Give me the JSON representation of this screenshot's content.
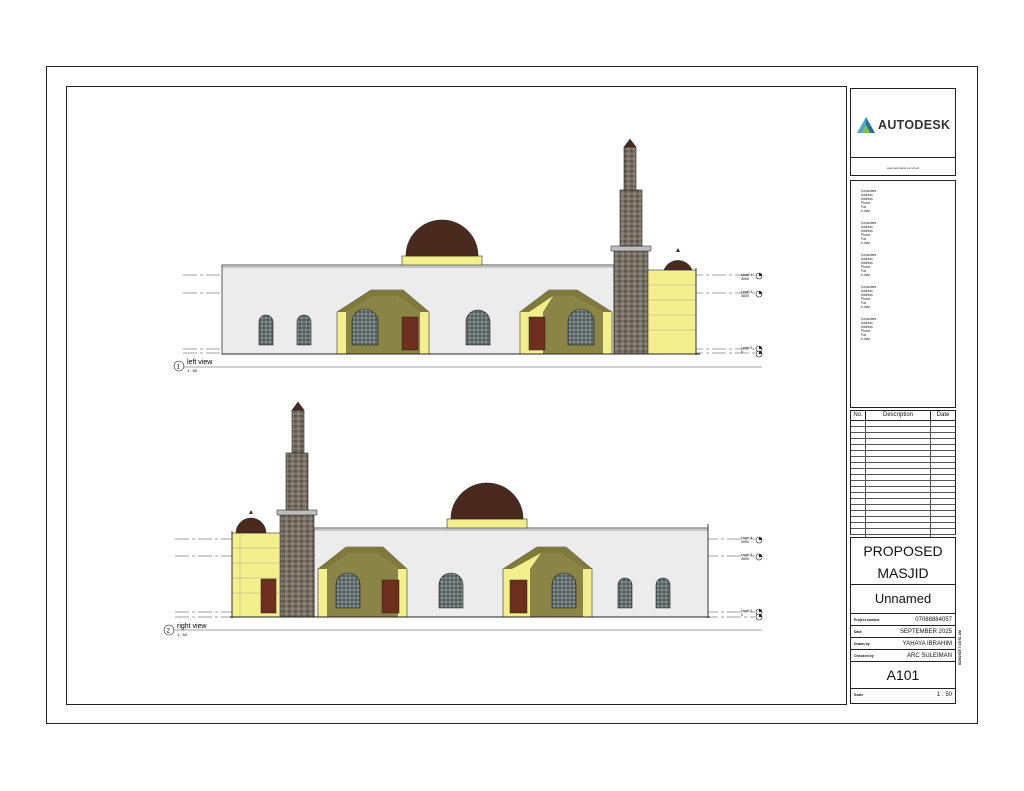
{
  "logo": {
    "name": "AUTODESK",
    "subtitle": "www.autodesk.com/revit"
  },
  "consultants": [
    [
      "Consultant",
      "Address",
      "Address",
      "Phone",
      "Fax",
      "e-mail"
    ],
    [
      "Consultant",
      "Address",
      "Address",
      "Phone",
      "Fax",
      "e-mail"
    ],
    [
      "Consultant",
      "Address",
      "Address",
      "Phone",
      "Fax",
      "e-mail"
    ],
    [
      "Consultant",
      "Address",
      "Address",
      "Phone",
      "Fax",
      "e-mail"
    ],
    [
      "Consultant",
      "Address",
      "Address",
      "Phone",
      "Fax",
      "e-mail"
    ]
  ],
  "revisions": {
    "col_no": "No.",
    "col_desc": "Description",
    "col_date": "Date"
  },
  "title": {
    "line1": "PROPOSED",
    "line2": "MASJID",
    "owner": "Unnamed",
    "project_number_label": "Project number",
    "project_number": "07088884057",
    "date_label": "Date",
    "date": "SEPTEMBER 2025",
    "drawn_label": "Drawn by",
    "drawn_by": "YAHAYA IBRAHIM",
    "checked_label": "Checked by",
    "checked_by": "ARC SULEIMAN",
    "sheet": "A101",
    "scale_label": "Scale",
    "scale": "1 : 50",
    "side_note": "8/29/2025 7:19:51 AM"
  },
  "views": [
    {
      "number": "1",
      "name": "left view",
      "scale": "1 : 50",
      "levels": [
        {
          "name": "Level 4",
          "elev": "3000"
        },
        {
          "name": "Level 3",
          "elev": "3000"
        },
        {
          "name": "Level 2",
          "elev": "0"
        }
      ]
    },
    {
      "number": "2",
      "name": "right view",
      "scale": "1 : 50",
      "levels": [
        {
          "name": "Level 4",
          "elev": "3000"
        },
        {
          "name": "Level 3",
          "elev": "3000"
        },
        {
          "name": "Level 2",
          "elev": "0"
        }
      ]
    }
  ],
  "colors": {
    "wall": "#ececec",
    "yellow": "#f3ef8c",
    "olive": "#7f7a3b",
    "dome": "#4a2a1e",
    "stone": "#6b6358",
    "door": "#6e2f1e"
  }
}
